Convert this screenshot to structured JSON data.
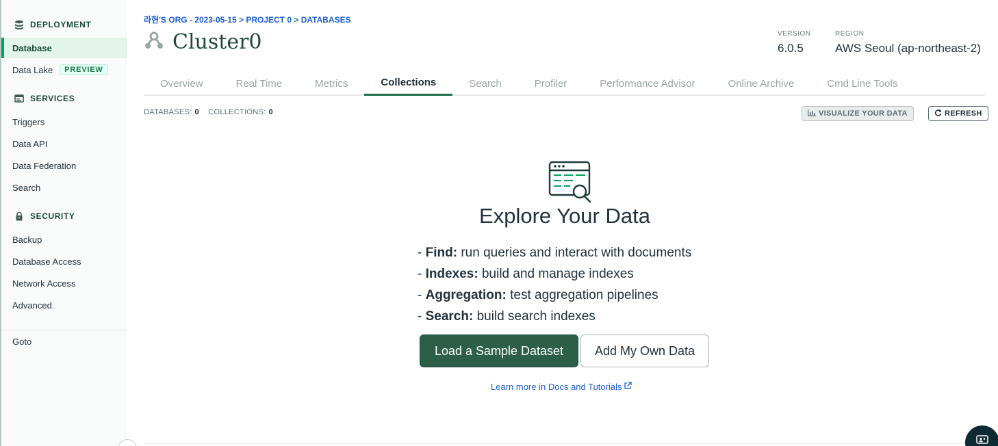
{
  "sidebar": {
    "sections": [
      {
        "title": "DEPLOYMENT",
        "icon": "stack-icon"
      },
      {
        "title": "SERVICES",
        "icon": "terminal-icon"
      },
      {
        "title": "SECURITY",
        "icon": "lock-icon"
      }
    ],
    "deployment_items": [
      {
        "label": "Database",
        "active": true
      },
      {
        "label": "Data Lake",
        "badge": "PREVIEW"
      }
    ],
    "services_items": [
      {
        "label": "Triggers"
      },
      {
        "label": "Data API"
      },
      {
        "label": "Data Federation"
      },
      {
        "label": "Search"
      }
    ],
    "security_items": [
      {
        "label": "Backup"
      },
      {
        "label": "Database Access"
      },
      {
        "label": "Network Access"
      },
      {
        "label": "Advanced"
      }
    ],
    "goto_label": "Goto"
  },
  "header": {
    "breadcrumb": "라현'S ORG - 2023-05-15 > PROJECT 0 > DATABASES",
    "cluster_name": "Cluster0",
    "version_label": "VERSION",
    "version_value": "6.0.5",
    "region_label": "REGION",
    "region_value": "AWS Seoul (ap-northeast-2)"
  },
  "tabs": [
    {
      "label": "Overview"
    },
    {
      "label": "Real Time"
    },
    {
      "label": "Metrics"
    },
    {
      "label": "Collections",
      "active": true
    },
    {
      "label": "Search"
    },
    {
      "label": "Profiler"
    },
    {
      "label": "Performance Advisor"
    },
    {
      "label": "Online Archive"
    },
    {
      "label": "Cmd Line Tools"
    }
  ],
  "stats": {
    "databases_label": "DATABASES:",
    "databases_value": "0",
    "collections_label": "COLLECTIONS:",
    "collections_value": "0"
  },
  "toolbar": {
    "visualize_label": "VISUALIZE YOUR DATA",
    "refresh_label": "REFRESH"
  },
  "empty_state": {
    "title": "Explore Your Data",
    "features": [
      {
        "name": "Find:",
        "desc": "run queries and interact with documents"
      },
      {
        "name": "Indexes:",
        "desc": "build and manage indexes"
      },
      {
        "name": "Aggregation:",
        "desc": "test aggregation pipelines"
      },
      {
        "name": "Search:",
        "desc": "build search indexes"
      }
    ],
    "primary_button": "Load a Sample Dataset",
    "secondary_button": "Add My Own Data",
    "docs_link": "Learn more in Docs and Tutorials"
  },
  "colors": {
    "accent_green": "#00a35c",
    "dark_green": "#2d5f48",
    "link_blue": "#1b5fd6"
  }
}
